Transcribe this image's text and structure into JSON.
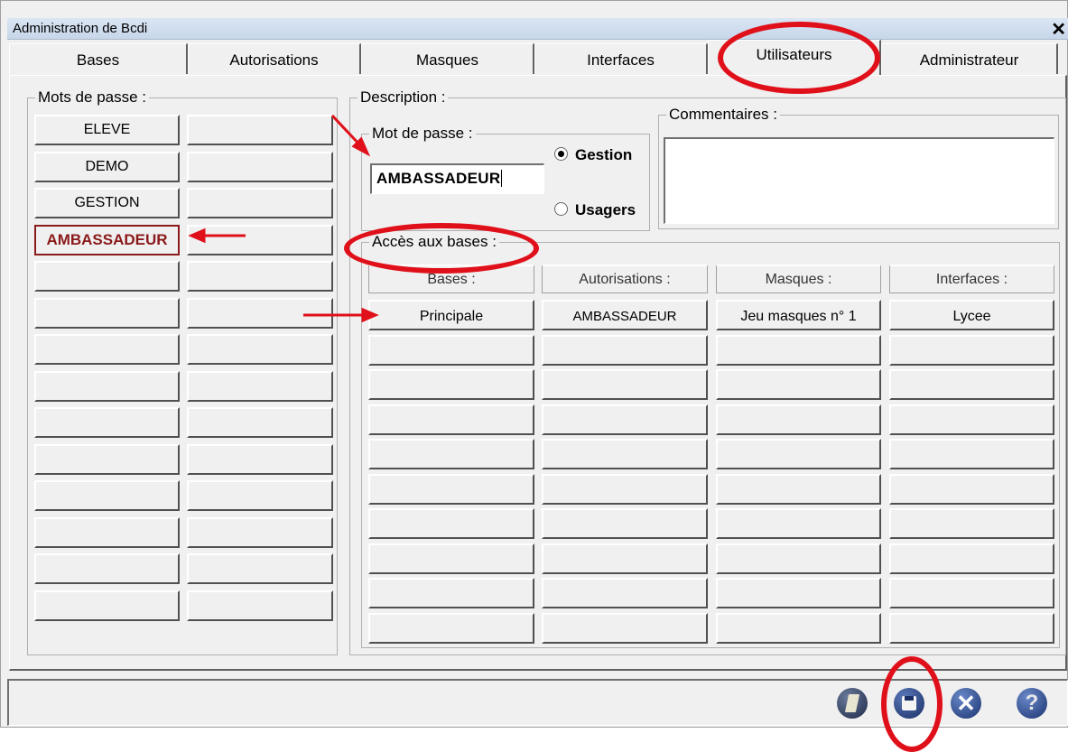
{
  "window": {
    "title": "Administration de Bcdi"
  },
  "tabs": [
    "Bases",
    "Autorisations",
    "Masques",
    "Interfaces",
    "Utilisateurs",
    "Administrateur"
  ],
  "passwords_group": {
    "label": "Mots de passe :",
    "items": [
      "ELEVE",
      "DEMO",
      "GESTION",
      "AMBASSADEUR"
    ]
  },
  "description": {
    "label": "Description :",
    "password_group_label": "Mot de passe :",
    "password_value": "AMBASSADEUR",
    "radio_gestion": "Gestion",
    "radio_usagers": "Usagers",
    "comments_label": "Commentaires :",
    "access_label": "Accès aux bases :",
    "columns": [
      "Bases :",
      "Autorisations :",
      "Masques :",
      "Interfaces :"
    ],
    "row1": [
      "Principale",
      "AMBASSADEUR",
      "Jeu masques n° 1",
      "Lycee"
    ]
  },
  "colors": {
    "annotation": "#e0101a",
    "selected_text": "#8b1a1a",
    "accent_blue": "#2a4a8c"
  }
}
